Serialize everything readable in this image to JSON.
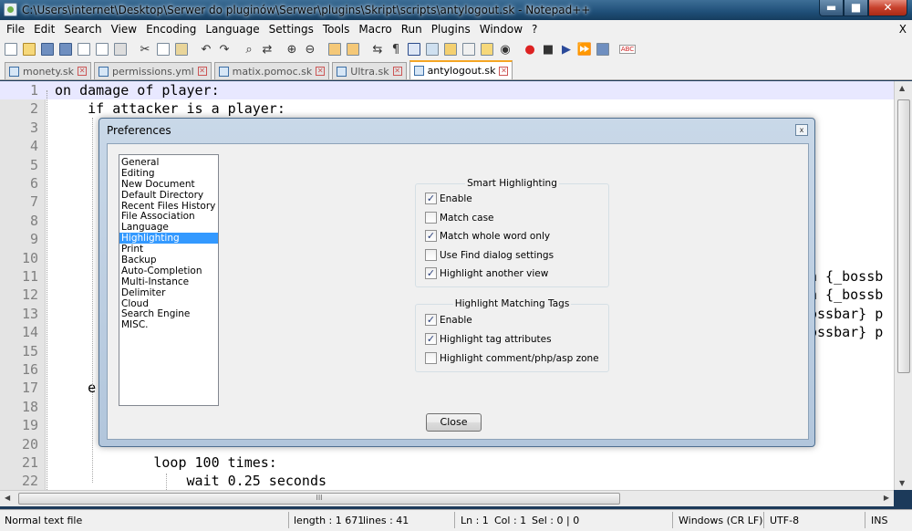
{
  "window": {
    "title": "C:\\Users\\internet\\Desktop\\Serwer do pluginów\\Serwer\\plugins\\Skript\\scripts\\antylogout.sk - Notepad++",
    "min": "▬",
    "max": "■",
    "close": "✕"
  },
  "menu": [
    "File",
    "Edit",
    "Search",
    "View",
    "Encoding",
    "Language",
    "Settings",
    "Tools",
    "Macro",
    "Run",
    "Plugins",
    "Window",
    "?"
  ],
  "menu_close": "X",
  "toolbar_spell": "ABC",
  "tabs": [
    {
      "label": "monety.sk"
    },
    {
      "label": "permissions.yml"
    },
    {
      "label": "matix.pomoc.sk"
    },
    {
      "label": "Ultra.sk"
    },
    {
      "label": "antylogout.sk"
    }
  ],
  "editor": {
    "lines": [
      {
        "n": "1",
        "code": "on damage of player:"
      },
      {
        "n": "2",
        "code": "    if attacker is a player:"
      },
      {
        "n": "3",
        "code": ""
      },
      {
        "n": "4",
        "code": ""
      },
      {
        "n": "5",
        "code": ""
      },
      {
        "n": "6",
        "code": ""
      },
      {
        "n": "7",
        "code": ""
      },
      {
        "n": "8",
        "code": ""
      },
      {
        "n": "9",
        "code": ""
      },
      {
        "n": "10",
        "code": ""
      },
      {
        "n": "11",
        "code": ""
      },
      {
        "n": "12",
        "code": ""
      },
      {
        "n": "13",
        "code": ""
      },
      {
        "n": "14",
        "code": ""
      },
      {
        "n": "15",
        "code": ""
      },
      {
        "n": "16",
        "code": ""
      },
      {
        "n": "17",
        "code": "    e"
      },
      {
        "n": "18",
        "code": ""
      },
      {
        "n": "19",
        "code": ""
      },
      {
        "n": "20",
        "code": ""
      },
      {
        "n": "21",
        "code": "            loop 100 times:"
      },
      {
        "n": "22",
        "code": "                wait 0.25 seconds"
      }
    ],
    "right_fragments": [
      {
        "line": "11",
        "text": "h {_bossb"
      },
      {
        "line": "12",
        "text": "h {_bossb"
      },
      {
        "line": "13",
        "text": "ossbar} p"
      },
      {
        "line": "14",
        "text": "ossbar} p"
      }
    ]
  },
  "dialog": {
    "title": "Preferences",
    "close_glyph": "x",
    "categories": [
      "General",
      "Editing",
      "New Document",
      "Default Directory",
      "Recent Files History",
      "File Association",
      "Language",
      "Highlighting",
      "Print",
      "Backup",
      "Auto-Completion",
      "Multi-Instance",
      "Delimiter",
      "Cloud",
      "Search Engine",
      "MISC."
    ],
    "selected_category": "Highlighting",
    "smart": {
      "title": "Smart Highlighting",
      "options": [
        {
          "label": "Enable",
          "checked": true
        },
        {
          "label": "Match case",
          "checked": false
        },
        {
          "label": "Match whole word only",
          "checked": true
        },
        {
          "label": "Use Find dialog settings",
          "checked": false
        },
        {
          "label": "Highlight another view",
          "checked": true
        }
      ]
    },
    "tags": {
      "title": "Highlight Matching Tags",
      "options": [
        {
          "label": "Enable",
          "checked": true
        },
        {
          "label": "Highlight tag attributes",
          "checked": true
        },
        {
          "label": "Highlight comment/php/asp zone",
          "checked": false
        }
      ]
    },
    "close_label": "Close"
  },
  "status": {
    "file_type": "Normal text file",
    "length": "length : 1 671",
    "lines": "lines : 41",
    "ln": "Ln : 1",
    "col": "Col : 1",
    "sel": "Sel : 0 | 0",
    "eol": "Windows (CR LF)",
    "encoding": "UTF-8",
    "mode": "INS"
  },
  "scroll_grip": "III"
}
